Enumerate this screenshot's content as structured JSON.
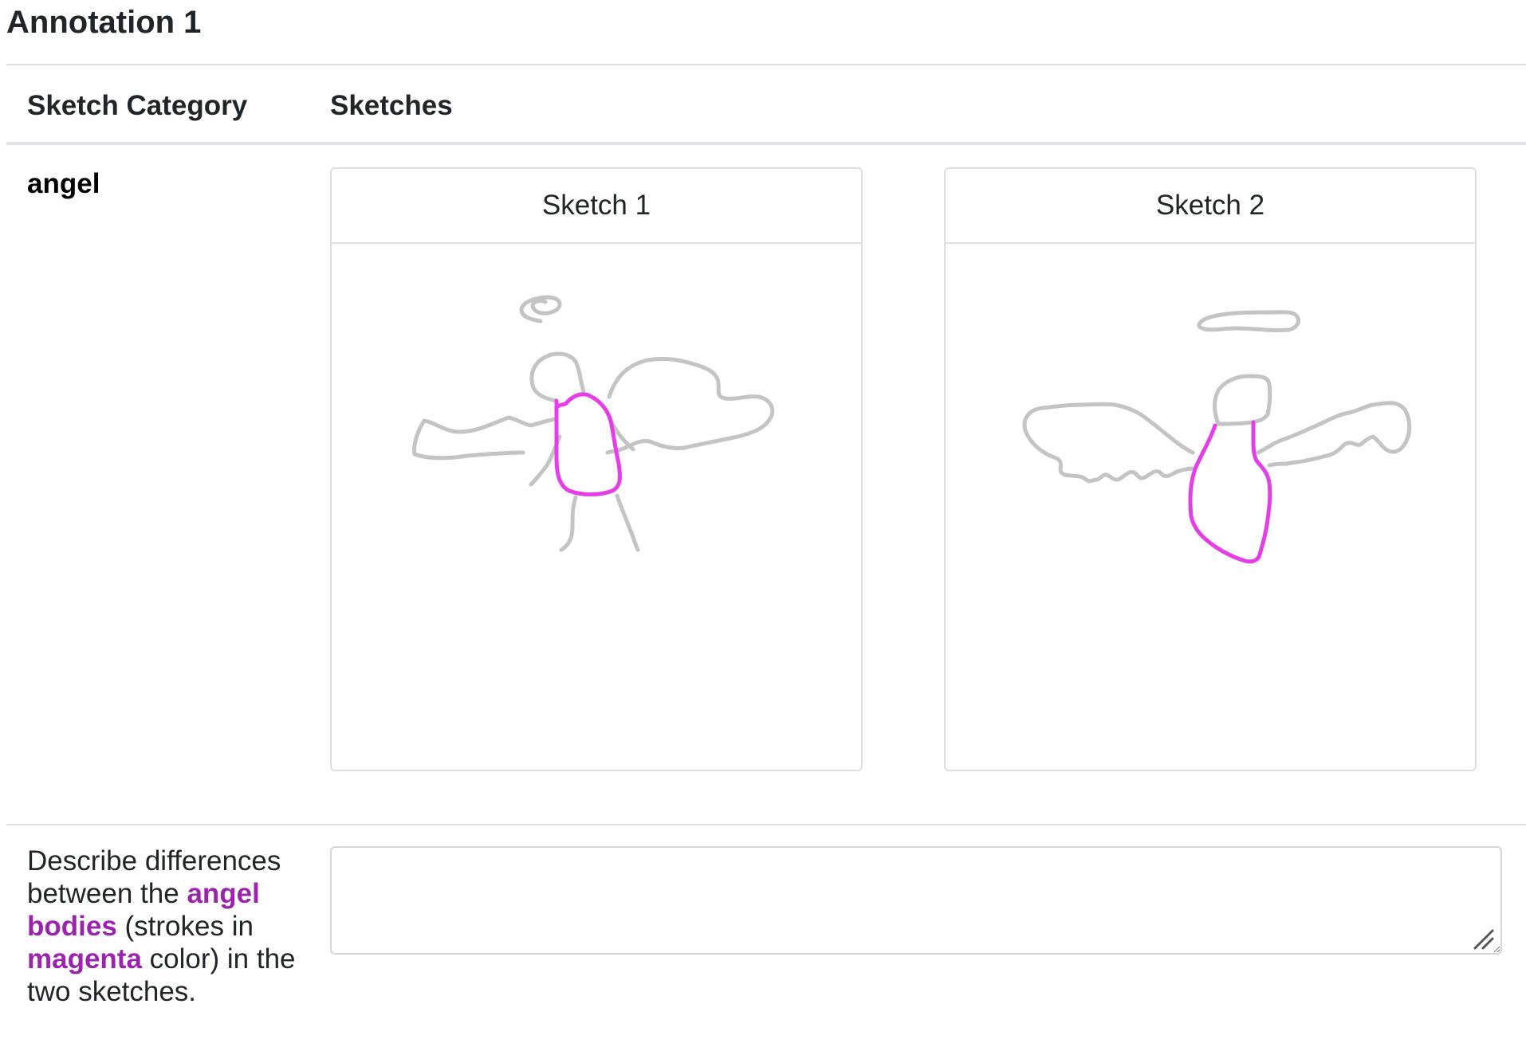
{
  "page": {
    "title": "Annotation 1"
  },
  "table": {
    "headers": {
      "category": "Sketch Category",
      "sketches": "Sketches"
    },
    "row": {
      "category": "angel",
      "sketches": [
        {
          "label": "Sketch 1"
        },
        {
          "label": "Sketch 2"
        }
      ]
    }
  },
  "prompt": {
    "part1": "Describe differences between the ",
    "highlight1": "angel bodies",
    "part2": " (strokes in ",
    "highlight2": "magenta",
    "part3": " color) in the two sketches."
  },
  "answer": {
    "value": "",
    "placeholder": ""
  },
  "colors": {
    "stroke_context": "#c4c4c4",
    "stroke_highlight": "#e63ee6",
    "highlight_text": "#9b24ad"
  }
}
